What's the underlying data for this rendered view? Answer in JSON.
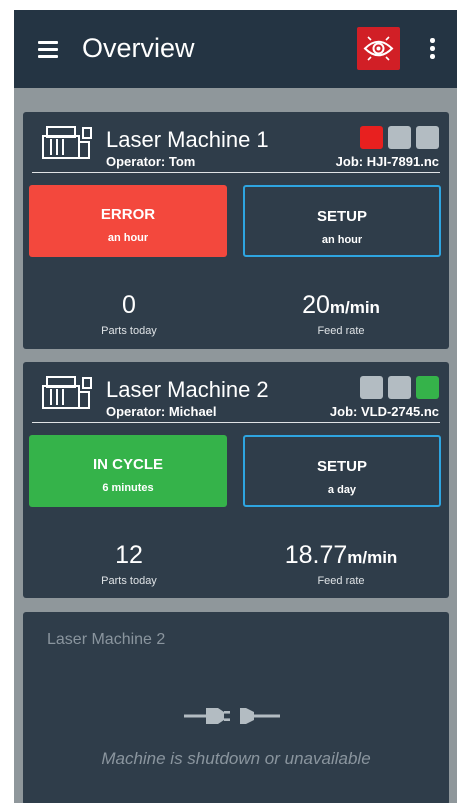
{
  "appbar": {
    "title": "Overview",
    "menu_icon": "hamburger-menu-icon",
    "eye_icon": "eye-icon",
    "more_icon": "more-vert-icon",
    "eye_button_color": "#d11f26"
  },
  "machines": [
    {
      "name": "Laser Machine 1",
      "operator": "Operator: Tom",
      "job": "Job: HJI-7891.nc",
      "lights": [
        "#e8201f",
        "#b3bcc2",
        "#b3bcc2"
      ],
      "status": {
        "label": "ERROR",
        "since": "an hour",
        "color": "#f3483d"
      },
      "mode": {
        "label": "SETUP",
        "since": "an hour",
        "border": "#2ea5e0"
      },
      "parts": {
        "value": "0",
        "label": "Parts today"
      },
      "feed": {
        "value": "20",
        "unit": "m/min",
        "label": "Feed rate"
      }
    },
    {
      "name": "Laser Machine 2",
      "operator": "Operator: Michael",
      "job": "Job: VLD-2745.nc",
      "lights": [
        "#b3bcc2",
        "#b3bcc2",
        "#35b34a"
      ],
      "status": {
        "label": "IN CYCLE",
        "since": "6 minutes",
        "color": "#35b34a"
      },
      "mode": {
        "label": "SETUP",
        "since": "a day",
        "border": "#2ea5e0"
      },
      "parts": {
        "value": "12",
        "label": "Parts today"
      },
      "feed": {
        "value": "18.77",
        "unit": "m/min",
        "label": "Feed rate"
      }
    }
  ],
  "offline_machine": {
    "name": "Laser Machine 2",
    "message": "Machine is shutdown or unavailable",
    "icon": "unplugged-icon"
  },
  "colors": {
    "appbar": "#243443",
    "background": "#8f979b",
    "card": "#2f3d4a",
    "accent_blue": "#2ea5e0"
  }
}
